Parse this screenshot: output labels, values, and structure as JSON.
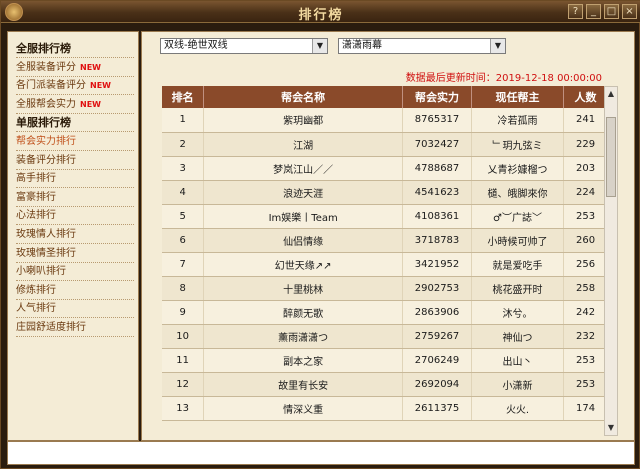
{
  "window": {
    "title": "排行榜"
  },
  "sidebar": {
    "items": [
      {
        "label": "全服排行榜",
        "type": "header",
        "new": ""
      },
      {
        "label": "全服装备评分",
        "type": "item",
        "new": "NEW"
      },
      {
        "label": "各门派装备评分",
        "type": "item",
        "new": "NEW"
      },
      {
        "label": "全服帮会实力",
        "type": "item",
        "new": "NEW"
      },
      {
        "label": "单服排行榜",
        "type": "header",
        "new": ""
      },
      {
        "label": "帮会实力排行",
        "type": "active",
        "new": ""
      },
      {
        "label": "装备评分排行",
        "type": "item",
        "new": ""
      },
      {
        "label": "高手排行",
        "type": "item",
        "new": ""
      },
      {
        "label": "富豪排行",
        "type": "item",
        "new": ""
      },
      {
        "label": "心法排行",
        "type": "item",
        "new": ""
      },
      {
        "label": "玫瑰情人排行",
        "type": "item",
        "new": ""
      },
      {
        "label": "玫瑰情圣排行",
        "type": "item",
        "new": ""
      },
      {
        "label": "小喇叭排行",
        "type": "item",
        "new": ""
      },
      {
        "label": "修炼排行",
        "type": "item",
        "new": ""
      },
      {
        "label": "人气排行",
        "type": "item",
        "new": ""
      },
      {
        "label": "庄园舒适度排行",
        "type": "item",
        "new": ""
      }
    ]
  },
  "filters": {
    "server_group": "双线-绝世双线",
    "server": "潇潇雨幕"
  },
  "updated_text": "数据最后更新时间：2019-12-18 00:00:00",
  "table": {
    "headers": [
      "排名",
      "帮会名称",
      "帮会实力",
      "现任帮主",
      "人数"
    ],
    "rows": [
      [
        "1",
        "紫玥幽都",
        "8765317",
        "冷若孤雨",
        "241"
      ],
      [
        "2",
        "江湖",
        "7032427",
        "﹂玥九弦ミ",
        "229"
      ],
      [
        "3",
        "梦岚江山／／",
        "4788687",
        "乂青衫嫝榴つ",
        "203"
      ],
      [
        "4",
        "浪迹天涯",
        "4541623",
        "檤、皒脚來你",
        "224"
      ],
      [
        "5",
        "Im娱樂丨Team",
        "4108361",
        "♂︶广誌﹀",
        "253"
      ],
      [
        "6",
        "仙侣情缘",
        "3718783",
        "小時候可帅了",
        "260"
      ],
      [
        "7",
        "幻世天缘↗↗",
        "3421952",
        "就是爱吃手",
        "256"
      ],
      [
        "8",
        "十里桃林",
        "2902753",
        "桃花盛开时",
        "258"
      ],
      [
        "9",
        "醉颜无歌",
        "2863906",
        "沐兮。",
        "242"
      ],
      [
        "10",
        "薰雨潇潇つ",
        "2759267",
        "神仙つ",
        "232"
      ],
      [
        "11",
        "副本之家",
        "2706249",
        "出山丶",
        "253"
      ],
      [
        "12",
        "故里有长安",
        "2692094",
        "小潇新",
        "253"
      ],
      [
        "13",
        "情深义重",
        "2611375",
        "火火.",
        "174"
      ]
    ]
  },
  "colors": {
    "header_bg": "#8a4a2a",
    "accent_red": "#d01010",
    "active_link": "#c0501a"
  }
}
